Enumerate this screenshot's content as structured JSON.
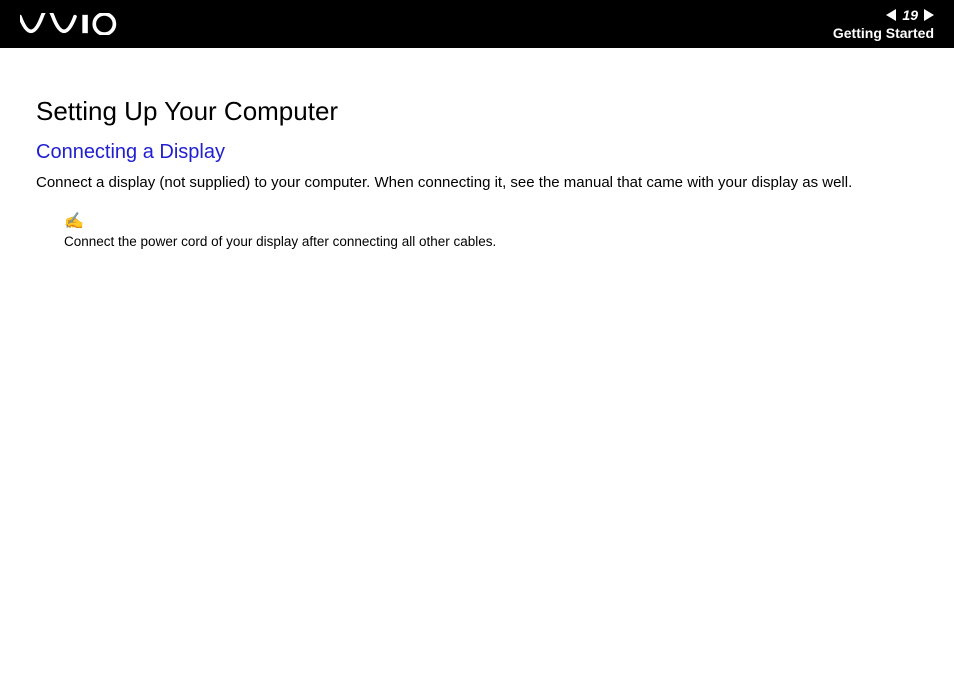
{
  "header": {
    "pageNumber": "19",
    "sectionName": "Getting Started"
  },
  "content": {
    "mainHeading": "Setting Up Your Computer",
    "subHeading": "Connecting a Display",
    "bodyText": "Connect a display (not supplied) to your computer. When connecting it, see the manual that came with your display as well.",
    "noteIcon": "✍",
    "noteText": "Connect the power cord of your display after connecting all other cables."
  }
}
